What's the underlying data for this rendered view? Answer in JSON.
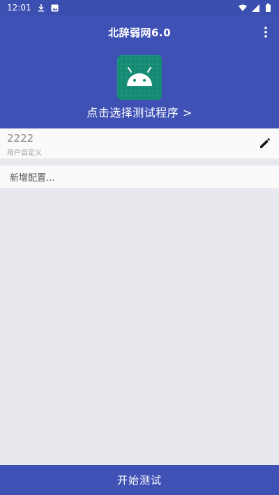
{
  "status_bar": {
    "time": "12:01",
    "icons": [
      "download-icon",
      "photo-icon",
      "wifi-icon",
      "signal-icon",
      "battery-icon"
    ]
  },
  "header": {
    "title": "北辞弱网6.0",
    "select_program": "点击选择测试程序 >",
    "app_icon": "android-icon"
  },
  "config": {
    "name": "2222",
    "subtitle": "用户自定义"
  },
  "new_config": {
    "label": "新增配置..."
  },
  "footer": {
    "start_label": "开始测试"
  },
  "colors": {
    "primary": "#3f51b5",
    "status_bar": "#3b4fb0",
    "icon_bg": "#148a72",
    "background": "#e8e9ee"
  }
}
